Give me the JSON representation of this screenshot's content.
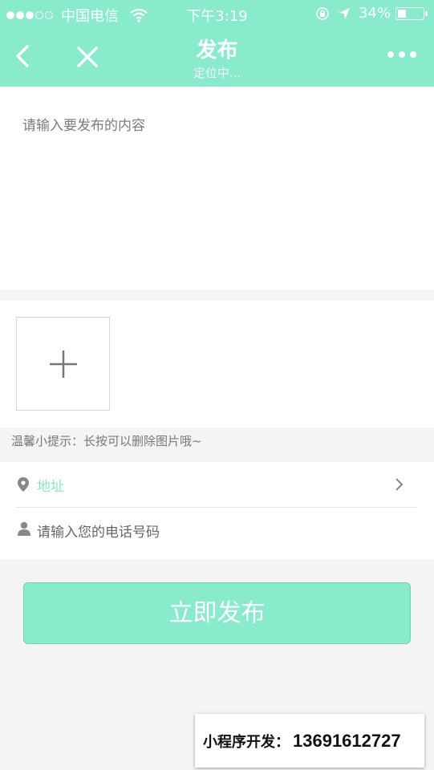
{
  "status_bar": {
    "carrier": "中国电信",
    "time": "下午3:19",
    "battery_text": "34%",
    "battery_level": 0.34,
    "signal_bars_filled": 3,
    "signal_bars_total": 5
  },
  "nav": {
    "title": "发布",
    "subtitle": "定位中..."
  },
  "content": {
    "placeholder": "请输入要发布的内容",
    "value": ""
  },
  "photos": {
    "tip": "温馨小提示：长按可以删除图片哦~"
  },
  "form": {
    "address_label": "地址",
    "phone_placeholder": "请输入您的电话号码",
    "phone_value": ""
  },
  "submit_label": "立即发布",
  "promo": {
    "label": "小程序开发：",
    "number": "13691612727"
  },
  "colors": {
    "accent": "#87ebcc",
    "background": "#f4f4f4"
  }
}
